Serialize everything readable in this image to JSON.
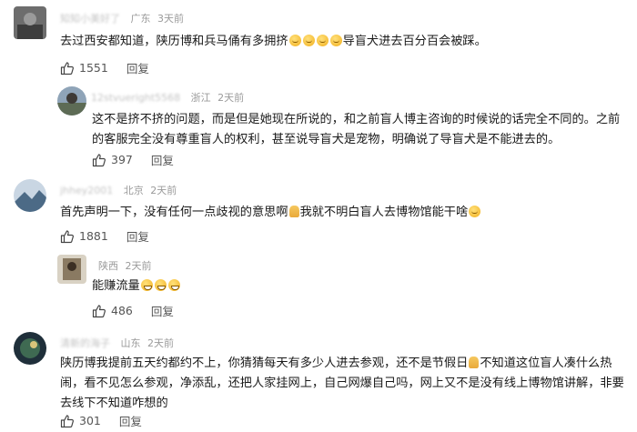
{
  "comments": [
    {
      "name": "知知小美好了",
      "location": "广东",
      "time": "3天前",
      "text_a": "去过西安都知道，陕历博和兵马俑有多拥挤",
      "text_b": "导盲犬进去百分百会被踩。",
      "likes": "1551",
      "reply": "回复"
    },
    {
      "name": "12stvueright5568",
      "location": "浙江",
      "time": "2天前",
      "text": "这不是挤不挤的问题，而是但是她现在所说的，和之前盲人博主咨询的时候说的话完全不同的。之前的客服完全没有尊重盲人的权利，甚至说导盲犬是宠物，明确说了导盲犬是不能进去的。",
      "likes": "397",
      "reply": "回复"
    },
    {
      "name": "jhhey2001",
      "location": "北京",
      "time": "2天前",
      "text_a": "首先声明一下，没有任何一点歧视的意思啊",
      "text_b": "我就不明白盲人去博物馆能干啥",
      "likes": "1881",
      "reply": "回复"
    },
    {
      "name": "",
      "location": "陕西",
      "time": "2天前",
      "text": "能赚流量",
      "likes": "486",
      "reply": "回复"
    },
    {
      "name": "清新的海子",
      "location": "山东",
      "time": "2天前",
      "text_a": "陕历博我提前五天约都约不上，你猜猜每天有多少人进去参观，还不是节假日",
      "text_b": "不知道这位盲人凑什么热闹，看不见怎么参观，净添乱，还把人家挂网上，自己网爆自己吗，网上又不是没有线上博物馆讲解，非要去线下不知道咋想的",
      "likes": "301",
      "reply": "回复"
    }
  ],
  "icons": {
    "like": "thumbs-up-icon"
  }
}
